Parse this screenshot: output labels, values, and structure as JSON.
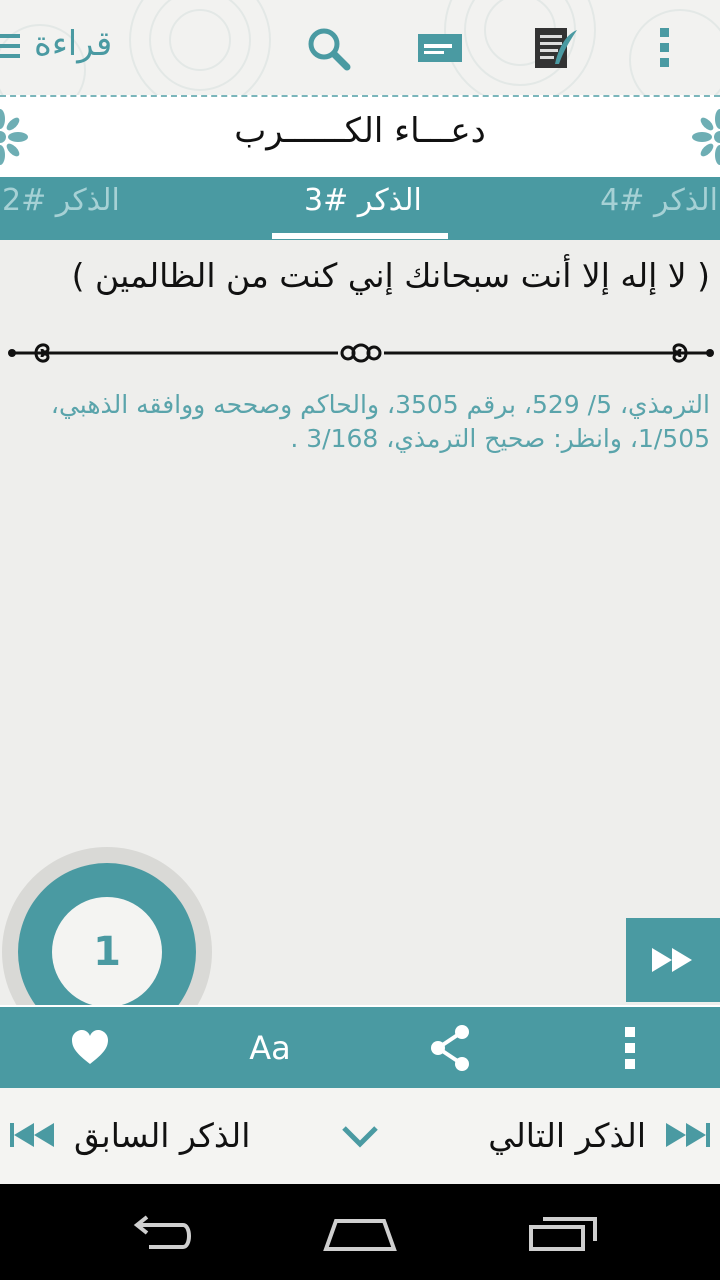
{
  "app": {
    "title": "قراءة",
    "accent_color": "#4a9aa2",
    "toolbar_icons": [
      "menu-icon",
      "search-icon",
      "notes-icon",
      "write-note-icon",
      "overflow-menu-icon"
    ]
  },
  "header": {
    "title": "دعـــاء الكــــــرب"
  },
  "tabs": [
    {
      "label": "الذكر #4",
      "active": false
    },
    {
      "label": "الذكر #3",
      "active": true
    },
    {
      "label": "الذكر #2",
      "active": false
    }
  ],
  "content": {
    "zikr_text": "( لا إله إلا أنت سبحانك إني كنت من الظالمين )",
    "source_text": "الترمذي، 5/ 529، برقم 3505، والحاكم وصححه ووافقه الذهبي، 1/505، وانظر: صحيح الترمذي، 3/168 ."
  },
  "counter": {
    "value": "1"
  },
  "action_bar": {
    "font_size_label": "Aa",
    "icons": [
      "heart-icon",
      "font-size-icon",
      "share-icon",
      "more-icon"
    ]
  },
  "navigation": {
    "previous_label": "الذكر السابق",
    "next_label": "الذكر التالي"
  },
  "system_bar": {
    "icons": [
      "back-icon",
      "home-icon",
      "recent-apps-icon"
    ]
  }
}
